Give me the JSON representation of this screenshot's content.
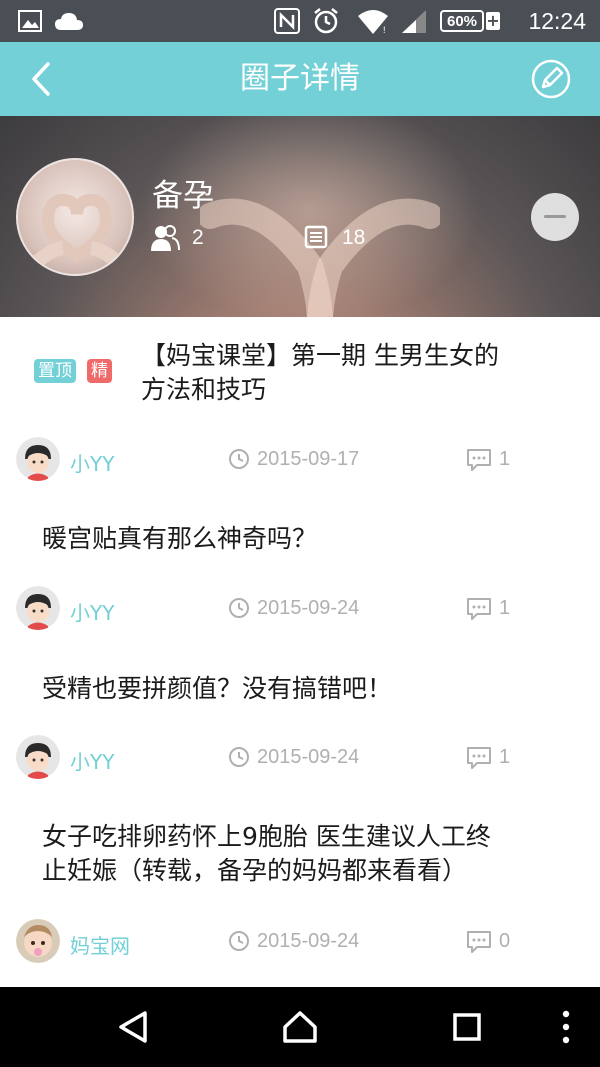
{
  "status_bar": {
    "time": "12:24",
    "battery": "60%",
    "battery_plus": "+",
    "icons": [
      "image-icon",
      "cloud-icon",
      "nfc-icon",
      "alarm-icon",
      "wifi-icon",
      "signal-icon",
      "battery-icon"
    ]
  },
  "header": {
    "title": "圈子详情",
    "back_icon": "back-arrow-icon",
    "edit_icon": "edit-icon"
  },
  "circle": {
    "name": "备孕",
    "members": "2",
    "posts": "18"
  },
  "posts": [
    {
      "tags": [
        "置顶",
        "精"
      ],
      "title_line1": "【妈宝课堂】第一期 生男生女的",
      "title_line2": "方法和技巧",
      "user": "小YY",
      "date": "2015-09-17",
      "comments": "1"
    },
    {
      "title_line1": "暖宫贴真有那么神奇吗？",
      "user": "小YY",
      "date": "2015-09-24",
      "comments": "1"
    },
    {
      "title_line1": "受精也要拼颜值？没有搞错吧！",
      "user": "小YY",
      "date": "2015-09-24",
      "comments": "1"
    },
    {
      "title_line1": "女子吃排卵药怀上9胞胎 医生建议人工终",
      "title_line2": "止妊娠（转载，备孕的妈妈都来看看）",
      "user": "妈宝网",
      "date": "2015-09-24",
      "comments": "0"
    }
  ],
  "colors": {
    "accent": "#72d0d6",
    "tag_top": "#72d0d6",
    "tag_jing": "#f06a6a",
    "meta_gray": "#b0b0b0"
  }
}
